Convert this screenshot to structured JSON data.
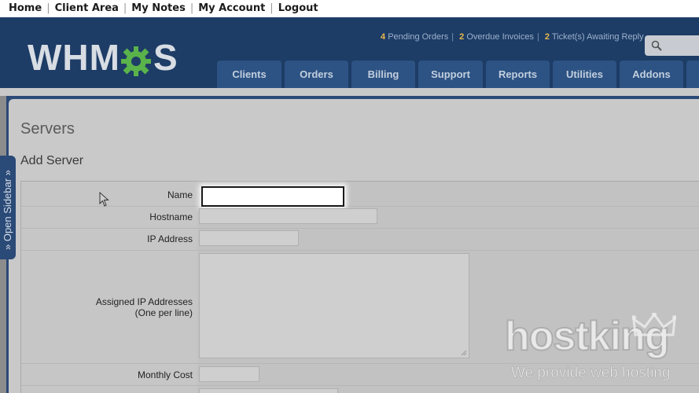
{
  "topbar": {
    "links": [
      "Home",
      "Client Area",
      "My Notes",
      "My Account",
      "Logout"
    ]
  },
  "header": {
    "logo_left": "WHM",
    "logo_right": "S",
    "stats": {
      "pending_count": "4",
      "pending_label": "Pending Orders",
      "overdue_count": "2",
      "overdue_label": "Overdue Invoices",
      "tickets_count": "2",
      "tickets_label": "Ticket(s) Awaiting Reply"
    },
    "search_icon": "search-icon"
  },
  "nav": {
    "tabs": [
      "Clients",
      "Orders",
      "Billing",
      "Support",
      "Reports",
      "Utilities",
      "Addons"
    ]
  },
  "sidebar": {
    "label": "» Open Sidebar »"
  },
  "page": {
    "title": "Servers",
    "section": "Add Server"
  },
  "form": {
    "name_label": "Name",
    "hostname_label": "Hostname",
    "ip_label": "IP Address",
    "assigned_ip_label_1": "Assigned IP Addresses",
    "assigned_ip_label_2": "(One per line)",
    "monthly_cost_label": "Monthly Cost"
  },
  "watermark": {
    "brand": "hostking",
    "tagline": "We provide web hosting"
  },
  "colors": {
    "header_bg": "#1d3c66",
    "tab_bg": "#2d5384",
    "stat_accent": "#e8b94a",
    "logo_gear": "#5ab34a"
  }
}
